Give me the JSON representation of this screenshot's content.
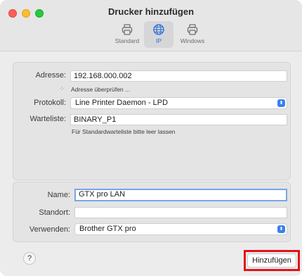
{
  "window": {
    "title": "Drucker hinzufügen"
  },
  "tabs": [
    {
      "label": "Standard",
      "icon": "printer-icon"
    },
    {
      "label": "IP",
      "icon": "globe-icon"
    },
    {
      "label": "Windows",
      "icon": "printer-icon"
    }
  ],
  "form": {
    "address_label": "Adresse:",
    "address_value": "192.168.000.002",
    "checking_text": "Adresse überprüfen ...",
    "protocol_label": "Protokoll:",
    "protocol_value": "Line Printer Daemon - LPD",
    "queue_label": "Warteliste:",
    "queue_value": "BINARY_P1",
    "queue_hint": "Für Standardwarteliste bitte leer lassen",
    "name_label": "Name:",
    "name_value": "GTX pro LAN",
    "location_label": "Standort:",
    "location_value": "",
    "use_label": "Verwenden:",
    "use_value": "Brother GTX pro"
  },
  "footer": {
    "help_label": "?",
    "add_label": "Hinzufügen"
  },
  "colors": {
    "accent": "#3b80f0",
    "highlight_frame": "#e2131a"
  }
}
